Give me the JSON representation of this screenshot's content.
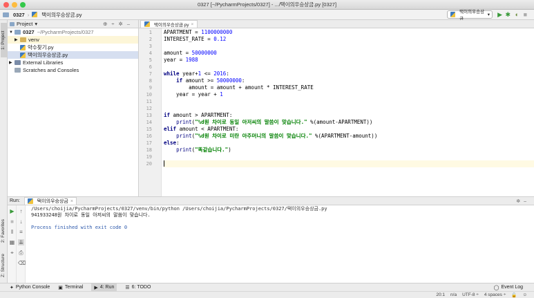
{
  "window": {
    "title": "0327 [~/PycharmProjects/0327] - .../택이의우승상금.py [0327]"
  },
  "nav": {
    "project": "0327",
    "file": "택이의우승상금.py"
  },
  "run_config": {
    "name": "택이의우승상금"
  },
  "left_tabs": {
    "project": "1: Project",
    "favorites": "2: Favorites",
    "structure": "Z: Structure"
  },
  "project_panel": {
    "header": "Project",
    "tree": [
      {
        "label": "0327",
        "suffix": "~/PycharmProjects/0327"
      },
      {
        "label": "venv"
      },
      {
        "label": "약수찾기.py"
      },
      {
        "label": "택이의우승상금.py"
      },
      {
        "label": "External Libraries"
      },
      {
        "label": "Scratches and Consoles"
      }
    ]
  },
  "editor": {
    "tab": "택이의우승상금.py",
    "line_numbers": [
      "1",
      "2",
      "3",
      "4",
      "5",
      "6",
      "7",
      "8",
      "9",
      "10",
      "11",
      "12",
      "13",
      "14",
      "15",
      "16",
      "17",
      "18",
      "19",
      "20"
    ],
    "lines": [
      "APARTMENT = 1100000000",
      "INTEREST_RATE = 0.12",
      "",
      "amount = 50000000",
      "year = 1988",
      "",
      "while year+1 <= 2016:",
      "    if amount >= 50000000:",
      "        amount = amount + amount * INTEREST_RATE",
      "    year = year + 1",
      "",
      "",
      "if amount > APARTMENT:",
      "    print(\"%d원 차이로 동일 아저씨의 말씀이 맞습니다.\" %(amount-APARTMENT))",
      "elif amount < APARTMENT:",
      "    print(\"%d원 차이로 미란 아주머니의 말씀이 맞습니다.\" %(APARTMENT-amount))",
      "else:",
      "    print(\"똑같습니다.\")",
      "",
      ""
    ]
  },
  "run_panel": {
    "label": "Run:",
    "tab": "택이의우승상금",
    "output": [
      "/Users/choijia/PycharmProjects/0327/venv/bin/python /Users/choijia/PycharmProjects/0327/택이의우승상금.py",
      "941933248원 차이로 동일 아저씨의 말씀이 맞습니다.",
      "",
      "Process finished with exit code 0"
    ]
  },
  "bottom_tabs": [
    {
      "label": "Python Console"
    },
    {
      "label": "Terminal"
    },
    {
      "label": "4: Run"
    },
    {
      "label": "6: TODO"
    }
  ],
  "event_log": "Event Log",
  "status": {
    "position": "20:1",
    "sep": "n/a",
    "encoding": "UTF-8 ÷",
    "indent": "4 spaces ÷"
  }
}
